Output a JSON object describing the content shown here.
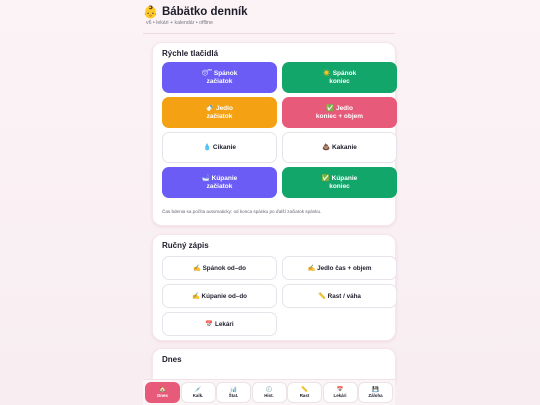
{
  "header": {
    "emoji": "👶",
    "title": "Bábätko denník",
    "subtitle": "v6 • lekári + kalendár • offline"
  },
  "quick": {
    "title": "Rýchle tlačidlá",
    "buttons": [
      {
        "icon": "😴",
        "line1": "Spánok",
        "line2": "začiatok",
        "color": "#6a5cf4"
      },
      {
        "icon": "☀️",
        "line1": "Spánok",
        "line2": "koniec",
        "color": "#12a66a"
      },
      {
        "icon": "🍼",
        "line1": "Jedlo",
        "line2": "začiatok",
        "color": "#f4a114"
      },
      {
        "icon": "✅",
        "line1": "Jedlo",
        "line2": "koniec + objem",
        "color": "#e85a7a"
      },
      {
        "icon": "💧",
        "line1": "Cikanie",
        "line2": "",
        "color": "#ffffff"
      },
      {
        "icon": "💩",
        "line1": "Kakanie",
        "line2": "",
        "color": "#ffffff"
      },
      {
        "icon": "🛁",
        "line1": "Kúpanie",
        "line2": "začiatok",
        "color": "#6a5cf4"
      },
      {
        "icon": "✅",
        "line1": "Kúpanie",
        "line2": "koniec",
        "color": "#12a66a"
      }
    ],
    "note": "Čas bdenia sa počíta automaticky: od konca spánku po ďalší začiatok spánku."
  },
  "manual": {
    "title": "Ručný zápis",
    "buttons": [
      {
        "icon": "✍️",
        "label": "Spánok od–do"
      },
      {
        "icon": "✍️",
        "label": "Jedlo čas + objem"
      },
      {
        "icon": "✍️",
        "label": "Kúpanie od–do"
      },
      {
        "icon": "📏",
        "label": "Rast / váha"
      },
      {
        "icon": "📅",
        "label": "Lekári"
      }
    ]
  },
  "today": {
    "title": "Dnes"
  },
  "nav": {
    "items": [
      {
        "icon": "🏠",
        "label": "Dnes",
        "active": true
      },
      {
        "icon": "💉",
        "label": "Kalk."
      },
      {
        "icon": "📊",
        "label": "Štat."
      },
      {
        "icon": "🕘",
        "label": "Hist."
      },
      {
        "icon": "📏",
        "label": "Rast"
      },
      {
        "icon": "📅",
        "label": "Lekári"
      },
      {
        "icon": "💾",
        "label": "Záloha"
      }
    ]
  },
  "colors": {
    "accent": "#e85a7a",
    "violet": "#6a5cf4",
    "green": "#12a66a",
    "orange": "#f4a114"
  }
}
